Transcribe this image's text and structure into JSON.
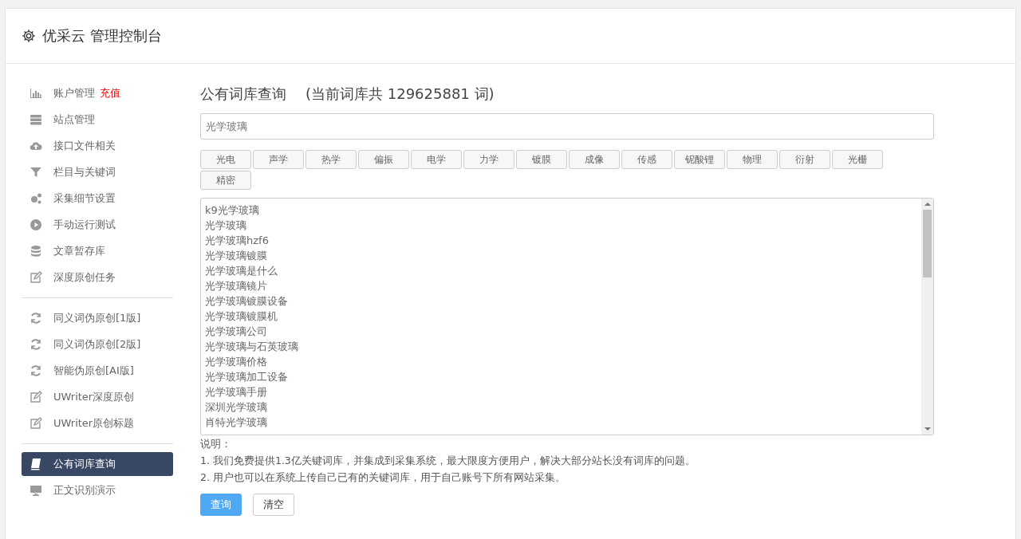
{
  "header": {
    "title": "优采云 管理控制台"
  },
  "sidebar": {
    "groups": [
      {
        "items": [
          {
            "label": "账户管理",
            "badge": "充值",
            "selected": false
          },
          {
            "label": "站点管理",
            "selected": false
          },
          {
            "label": "接口文件相关",
            "selected": false
          },
          {
            "label": "栏目与关键词",
            "selected": false
          },
          {
            "label": "采集细节设置",
            "selected": false
          },
          {
            "label": "手动运行测试",
            "selected": false
          },
          {
            "label": "文章暂存库",
            "selected": false
          },
          {
            "label": "深度原创任务",
            "selected": false
          }
        ]
      },
      {
        "items": [
          {
            "label": "同义词伪原创[1版]",
            "selected": false
          },
          {
            "label": "同义词伪原创[2版]",
            "selected": false
          },
          {
            "label": "智能伪原创[AI版]",
            "selected": false
          },
          {
            "label": "UWriter深度原创",
            "selected": false
          },
          {
            "label": "UWriter原创标题",
            "selected": false
          }
        ]
      },
      {
        "items": [
          {
            "label": "公有词库查询",
            "selected": true
          },
          {
            "label": "正文识别演示",
            "selected": false
          }
        ]
      }
    ]
  },
  "main": {
    "title": "公有词库查询",
    "count_note": "(当前词库共 129625881 词)",
    "search": {
      "value": "光学玻璃"
    },
    "tags": [
      "光电",
      "声学",
      "热学",
      "偏振",
      "电学",
      "力学",
      "镀膜",
      "成像",
      "传感",
      "铌酸锂",
      "物理",
      "衍射",
      "光栅",
      "精密"
    ],
    "results": [
      "k9光学玻璃",
      "光学玻璃",
      "光学玻璃hzf6",
      "光学玻璃镀膜",
      "光学玻璃是什么",
      "光学玻璃镜片",
      "光学玻璃镀膜设备",
      "光学玻璃镀膜机",
      "光学玻璃公司",
      "光学玻璃与石英玻璃",
      "光学玻璃价格",
      "光学玻璃加工设备",
      "光学玻璃手册",
      "深圳光学玻璃",
      "肖特光学玻璃"
    ],
    "notes_title": "说明：",
    "notes": [
      "1. 我们免费提供1.3亿关键词库，并集成到采集系统，最大限度方便用户，解决大部分站长没有词库的问题。",
      "2. 用户也可以在系统上传自己已有的关键词库，用于自己账号下所有网站采集。"
    ],
    "buttons": [
      {
        "label": "查询",
        "kind": "primary"
      },
      {
        "label": "清空",
        "kind": "default"
      }
    ]
  }
}
